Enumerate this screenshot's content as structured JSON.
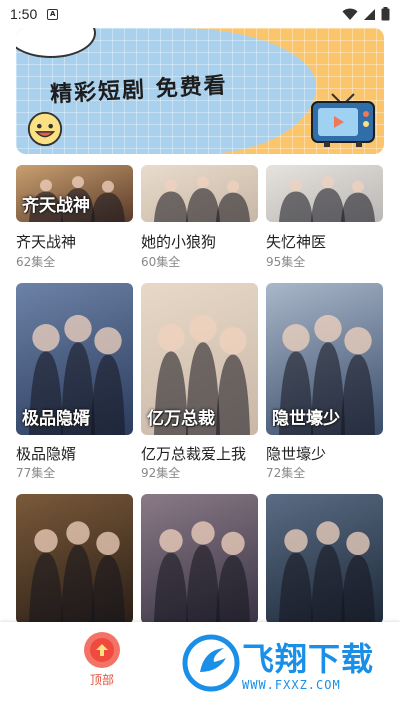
{
  "status_bar": {
    "time": "1:50",
    "notif_glyph": "A"
  },
  "banner": {
    "title": "精彩短剧 免费看"
  },
  "rows": [
    [
      {
        "title": "齐天战神",
        "episodes": "62集全",
        "poster_text": "齐天战神",
        "colors": [
          "#5a3a2a",
          "#c9a070"
        ]
      },
      {
        "title": "她的小狼狗",
        "episodes": "60集全",
        "poster_text": "",
        "colors": [
          "#c7b6a4",
          "#e9dccd"
        ]
      },
      {
        "title": "失忆神医",
        "episodes": "95集全",
        "poster_text": "",
        "colors": [
          "#b9b6b4",
          "#e6e2dd"
        ]
      }
    ],
    [
      {
        "title": "极品隐婿",
        "episodes": "77集全",
        "poster_text": "极品隐婿",
        "colors": [
          "#2b3c5e",
          "#6c82a6"
        ]
      },
      {
        "title": "亿万总裁爱上我",
        "episodes": "92集全",
        "poster_text": "亿万总裁",
        "colors": [
          "#c9b7a7",
          "#e8d9c7"
        ]
      },
      {
        "title": "隐世壕少",
        "episodes": "72集全",
        "poster_text": "隐世壕少",
        "colors": [
          "#3a4c6a",
          "#a9b7c9"
        ]
      }
    ],
    [
      {
        "title": "",
        "episodes": "",
        "poster_text": "",
        "colors": [
          "#2a1e16",
          "#7a5a3a"
        ]
      },
      {
        "title": "",
        "episodes": "",
        "poster_text": "",
        "colors": [
          "#3a3446",
          "#8a7a86"
        ]
      },
      {
        "title": "",
        "episodes": "",
        "poster_text": "",
        "colors": [
          "#1e2a3a",
          "#5a6c84"
        ]
      }
    ]
  ],
  "bottom_nav": {
    "top_label": "顶部"
  },
  "watermark": {
    "brand": "飞翔下载",
    "url": "WWW.FXXZ.COM"
  },
  "colors": {
    "accent": "#f04a3f",
    "watermark": "#1a8fe8"
  }
}
